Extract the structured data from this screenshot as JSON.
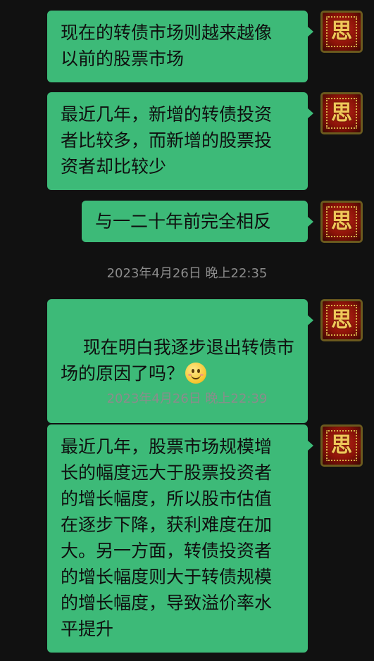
{
  "messages": [
    {
      "text": "现在的转债市场则越来越像\n以前的股票市场",
      "avatar_glyph": "思"
    },
    {
      "text": "最近几年，新增的转债投资\n者比较多，而新增的股票投\n资者却比较少",
      "avatar_glyph": "思"
    },
    {
      "text": "与一二十年前完全相反",
      "avatar_glyph": "思"
    },
    {
      "text": "现在明白我逐步退出转债市\n场的原因了吗？",
      "avatar_glyph": "思",
      "emoji": "smile-emoji"
    },
    {
      "text": "最近几年，股票市场规模增\n长的幅度远大于股票投资者\n的增长幅度，所以股市估值\n在逐步下降，获利难度在加\n大。另一方面，转债投资者\n的增长幅度则大于转债规模\n的增长幅度，导致溢价率水\n平提升",
      "avatar_glyph": "思"
    }
  ],
  "timestamps": [
    "2023年4月26日 晚上22:35",
    "2023年4月26日 晚上22:39"
  ],
  "colors": {
    "background": "#111111",
    "bubble": "#3dba78",
    "timestamp": "#8c8c8c"
  }
}
